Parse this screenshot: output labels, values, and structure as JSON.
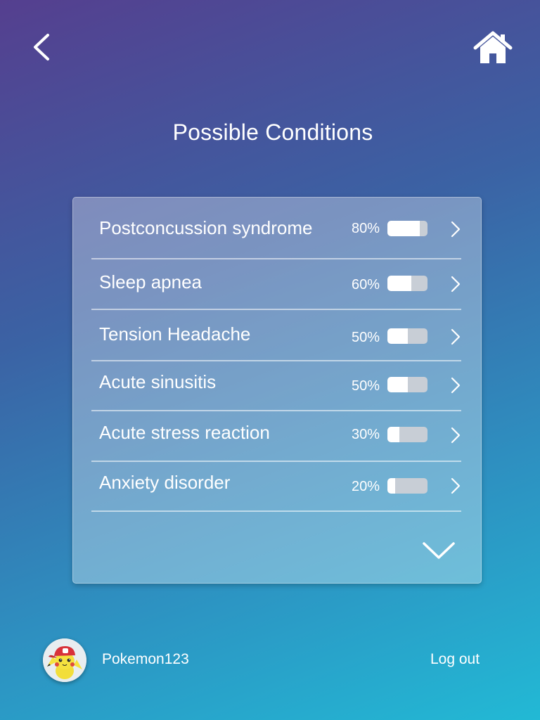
{
  "header": {
    "back_icon": "chevron-left-icon",
    "home_icon": "home-icon",
    "title": "Possible Conditions"
  },
  "conditions": [
    {
      "name": "Postconcussion syndrome",
      "percent_label": "80%",
      "likelihood": 0.8
    },
    {
      "name": "Sleep apnea",
      "percent_label": "60%",
      "likelihood": 0.6
    },
    {
      "name": "Tension Headache",
      "percent_label": "50%",
      "likelihood": 0.5
    },
    {
      "name": "Acute sinusitis",
      "percent_label": "50%",
      "likelihood": 0.5
    },
    {
      "name": "Acute stress reaction",
      "percent_label": "30%",
      "likelihood": 0.3
    },
    {
      "name": "Anxiety disorder",
      "percent_label": "20%",
      "likelihood": 0.2
    }
  ],
  "list": {
    "row_icon": "chevron-right-icon",
    "expand_icon": "chevron-down-icon"
  },
  "footer": {
    "username": "Pokemon123",
    "logout_label": "Log out",
    "avatar_icon": "pikachu-avatar"
  },
  "colors": {
    "gradient_start": "#553f8f",
    "gradient_end": "#22b9d5",
    "bar_track": "#c8ced6",
    "bar_fill": "#ffffff"
  }
}
